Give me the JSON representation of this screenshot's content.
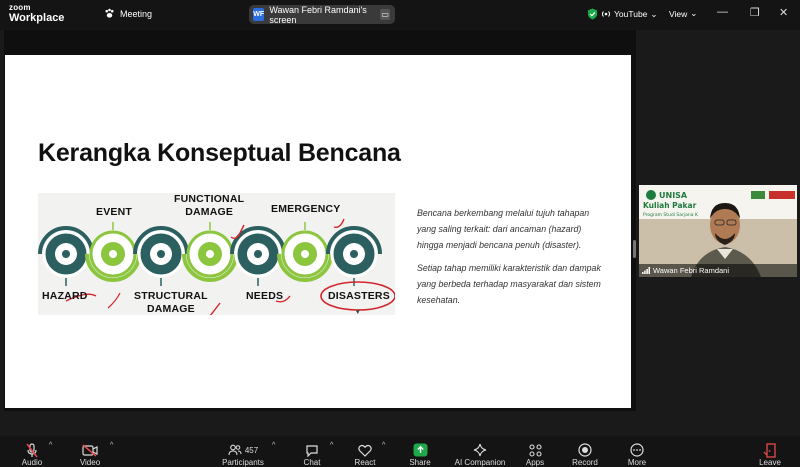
{
  "app": {
    "brand_top": "zoom",
    "brand_bottom": "Workplace",
    "meeting_label": "Meeting"
  },
  "share": {
    "initials": "WF",
    "label": "Wawan Febri Ramdani's screen"
  },
  "topright": {
    "youtube": "YouTube",
    "view": "View"
  },
  "slide": {
    "title": "Kerangka Konseptual Bencana",
    "labels": {
      "event": "EVENT",
      "functional": "FUNCTIONAL\nDAMAGE",
      "emergency": "EMERGENCY",
      "hazard": "HAZARD",
      "structural": "STRUCTURAL\nDAMAGE",
      "needs": "NEEDS",
      "disasters": "DISASTERS"
    },
    "para1": "Bencana berkembang melalui tujuh tahapan yang saling terkait: dari ancaman (hazard) hingga menjadi bencana penuh (disaster).",
    "para2": "Setiap tahap memiliki karakteristik dan dampak yang berbeda terhadap masyarakat dan sistem kesehatan."
  },
  "video": {
    "name": "Wawan Febri Ramdani",
    "banner_org": "UNISA",
    "banner_title": "Kuliah Pakar",
    "banner_sub": "Program Studi Sarjana K"
  },
  "toolbar": {
    "audio": "Audio",
    "video": "Video",
    "participants": "Participants",
    "participants_count": "457",
    "chat": "Chat",
    "react": "React",
    "share": "Share",
    "ai": "AI Companion",
    "apps": "Apps",
    "record": "Record",
    "more": "More",
    "leave": "Leave"
  },
  "colors": {
    "accent_green": "#8cc63f",
    "teal": "#2c5f60",
    "share_green": "#1ea84a",
    "leave_red": "#e5484d",
    "annotation_red": "#d4252b"
  }
}
